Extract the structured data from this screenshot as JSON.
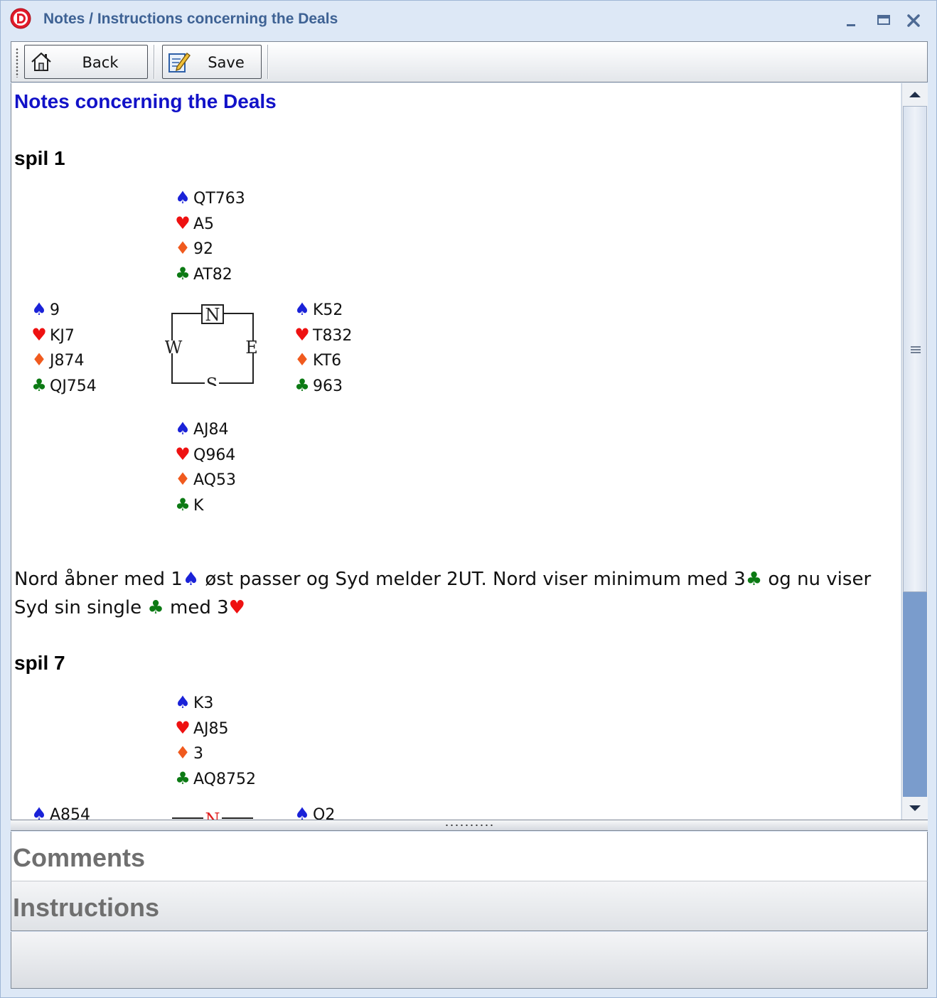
{
  "window": {
    "title": "Notes / Instructions concerning the Deals"
  },
  "toolbar": {
    "back_label": "Back",
    "save_label": "Save"
  },
  "document": {
    "title": "Notes concerning the Deals",
    "deals": [
      {
        "title": "spil 1",
        "north": {
          "spades": "QT763",
          "hearts": "A5",
          "diamonds": "92",
          "clubs": "AT82"
        },
        "west": {
          "spades": "9",
          "hearts": "KJ7",
          "diamonds": "J874",
          "clubs": "QJ754"
        },
        "east": {
          "spades": "K52",
          "hearts": "T832",
          "diamonds": "KT6",
          "clubs": "963"
        },
        "south": {
          "spades": "AJ84",
          "hearts": "Q964",
          "diamonds": "AQ53",
          "clubs": "K"
        },
        "compass": {
          "n": "N",
          "w": "W",
          "e": "E",
          "s": "S"
        },
        "note": {
          "p1": "Nord åbner med 1",
          "p2": " øst passer og Syd melder 2UT. Nord viser minimum med 3",
          "p3": " og nu viser Syd sin single ",
          "p4": " med 3"
        }
      },
      {
        "title": "spil 7",
        "north": {
          "spades": "K3",
          "hearts": "AJ85",
          "diamonds": "3",
          "clubs": "AQ8752"
        },
        "west": {
          "spades": "A854"
        },
        "east": {
          "spades": "Q2"
        },
        "compass": {
          "n": "N"
        }
      }
    ]
  },
  "panels": {
    "comments": "Comments",
    "instructions": "Instructions"
  },
  "icons": {
    "suits": {
      "spade": "♠",
      "heart": "♥",
      "diamond": "♦",
      "club": "♣"
    }
  },
  "colors": {
    "title_text": "#3e6294",
    "doc_title": "#1212c8",
    "spade": "#1a22d8",
    "heart": "#ee1111",
    "diamond": "#f05a1e",
    "club": "#0c7a14",
    "scroll_track": "#7a9ccc"
  }
}
